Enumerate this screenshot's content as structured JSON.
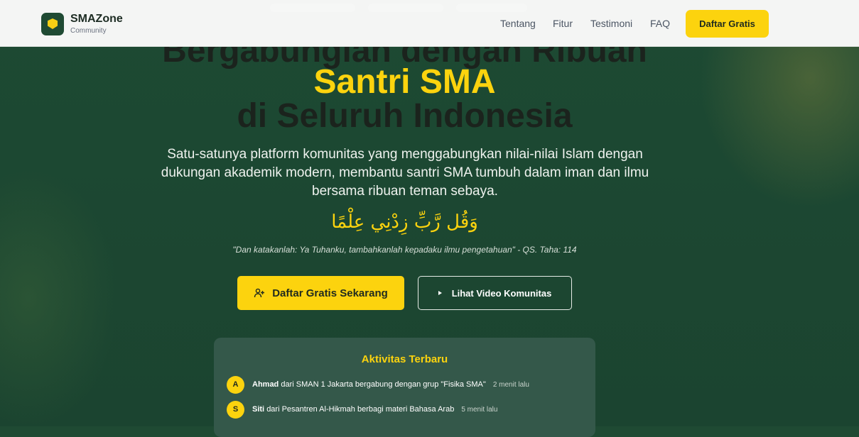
{
  "brand": {
    "name": "SMAZone",
    "subtitle": "Community"
  },
  "nav": {
    "links": [
      "Tentang",
      "Fitur",
      "Testimoni",
      "FAQ"
    ],
    "cta": "Daftar Gratis"
  },
  "hero": {
    "line1": "Bergabunglah dengan Ribuan",
    "line2": "Santri SMA",
    "line3": "di Seluruh Indonesia",
    "description": "Satu-satunya platform komunitas yang menggabungkan nilai-nilai Islam dengan dukungan akademik modern, membantu santri SMA tumbuh dalam iman dan ilmu bersama ribuan teman sebaya.",
    "arabic": "وَقُل رَّبِّ زِدْنِي عِلْمًا",
    "quote": "\"Dan katakanlah: Ya Tuhanku, tambahkanlah kepadaku ilmu pengetahuan\" - QS. Taha: 114",
    "primary_button": "Daftar Gratis Sekarang",
    "secondary_button": "Lihat Video Komunitas"
  },
  "activity": {
    "title": "Aktivitas Terbaru",
    "items": [
      {
        "initial": "A",
        "name": "Ahmad",
        "text": "dari SMAN 1 Jakarta bergabung dengan grup \"Fisika SMA\"",
        "time": "2 menit lalu"
      },
      {
        "initial": "S",
        "name": "Siti",
        "text": "dari Pesantren Al-Hikmah berbagi materi Bahasa Arab",
        "time": "5 menit lalu"
      }
    ]
  },
  "colors": {
    "primary_green": "#1f4a33",
    "accent_yellow": "#fcd30e"
  },
  "icons": {
    "logo": "shield-icon",
    "primary_button": "user-plus-icon",
    "secondary_button": "play-icon"
  }
}
